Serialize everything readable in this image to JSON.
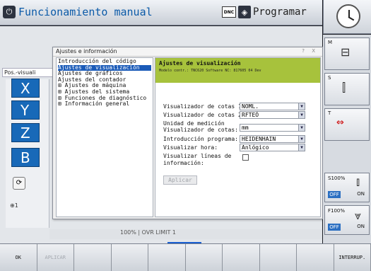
{
  "header": {
    "mode_left": "Funcionamiento manual",
    "dnc_label": "DNC",
    "mode_right": "Programar"
  },
  "workarea": {
    "pos_label": "Pos.-visuali",
    "axes": [
      "X",
      "Y",
      "Z",
      "B"
    ],
    "status_fragment": "100% | OVR    LIMIT 1"
  },
  "dialog": {
    "title": "Ajustes e información",
    "title_btns": "? X",
    "tree_items": [
      {
        "label": "Introducción del código",
        "selected": false
      },
      {
        "label": "Ajustes de visualización",
        "selected": true
      },
      {
        "label": "Ajustes de gráficos",
        "selected": false
      },
      {
        "label": "Ajustes del contador",
        "selected": false
      },
      {
        "label": "⊞ Ajustes de máquina",
        "selected": false
      },
      {
        "label": "⊞ Ajustes del sistema",
        "selected": false
      },
      {
        "label": "⊞ Funciones de diagnóstico",
        "selected": false
      },
      {
        "label": "⊞ Información general",
        "selected": false
      }
    ],
    "content": {
      "title": "Ajustes de visualización",
      "subtitle": "Modelo contr.: TNC620      Software NC: 817605 04 Dev",
      "fields": [
        {
          "label": "Visualizador de cotas 1:",
          "value": "NOML."
        },
        {
          "label": "Visualizador de cotas 2:",
          "value": "RFTEÓ"
        },
        {
          "label": "Unidad de medición",
          "value": ""
        },
        {
          "label": "Visualizador de cotas:",
          "value": "mm"
        },
        {
          "label": "Introducción programa:",
          "value": "HEIDENHAIN"
        },
        {
          "label": "Visualizar hora:",
          "value": "Anlógico"
        }
      ],
      "checkbox_label_1": "Visualizar líneas de",
      "checkbox_label_2": "información:",
      "apply_label": "Aplicar"
    }
  },
  "rightbar": {
    "tags": [
      "M",
      "S",
      "T"
    ],
    "spindle_override": "S100%",
    "feed_override": "F100%",
    "off_label": "OFF",
    "on_label": "ON"
  },
  "softkeys": [
    "OK",
    "APLICAR",
    "",
    "",
    "",
    "",
    "",
    "",
    "",
    "INTERRUP."
  ]
}
